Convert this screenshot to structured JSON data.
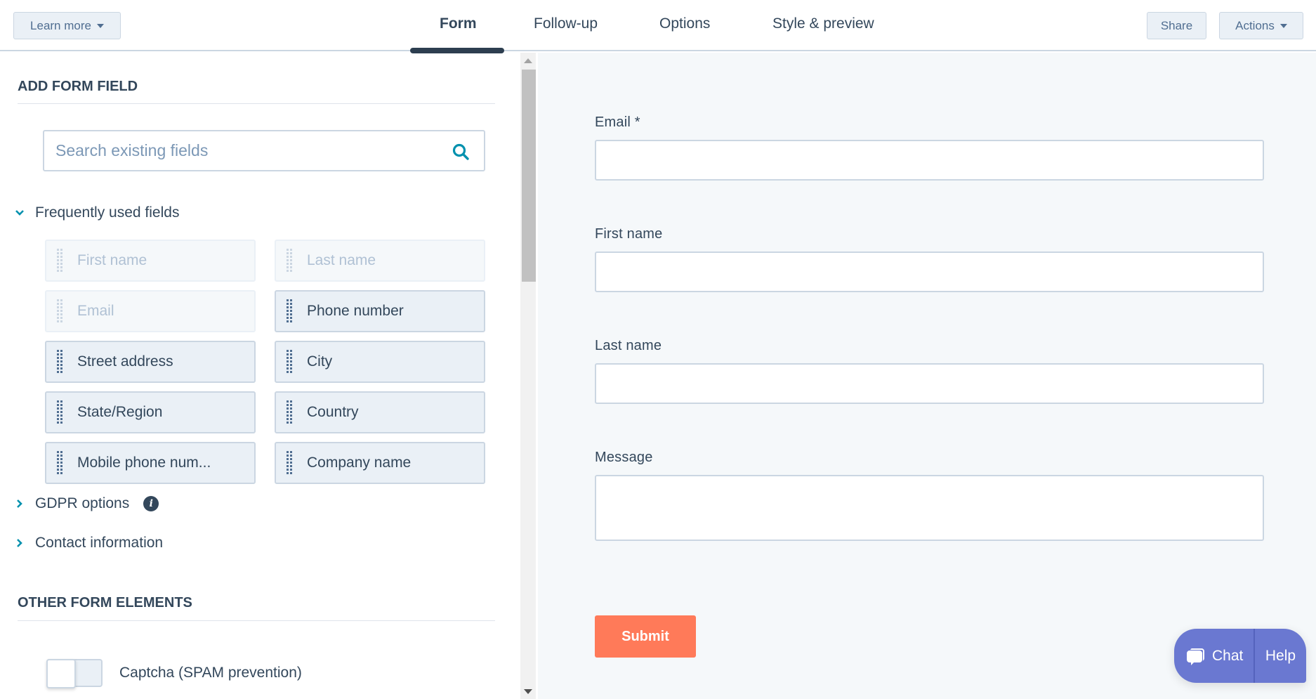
{
  "header": {
    "learn_more": "Learn more",
    "tabs": [
      {
        "label": "Form",
        "active": true
      },
      {
        "label": "Follow-up",
        "active": false
      },
      {
        "label": "Options",
        "active": false
      },
      {
        "label": "Style & preview",
        "active": false
      }
    ],
    "share": "Share",
    "actions": "Actions"
  },
  "left_panel": {
    "add_form_field_title": "ADD FORM FIELD",
    "search": {
      "placeholder": "Search existing fields",
      "value": ""
    },
    "frequently_used": {
      "label": "Frequently used fields",
      "expanded": true,
      "fields": [
        {
          "label": "First name",
          "enabled": false
        },
        {
          "label": "Last name",
          "enabled": false
        },
        {
          "label": "Email",
          "enabled": false
        },
        {
          "label": "Phone number",
          "enabled": true
        },
        {
          "label": "Street address",
          "enabled": true
        },
        {
          "label": "City",
          "enabled": true
        },
        {
          "label": "State/Region",
          "enabled": true
        },
        {
          "label": "Country",
          "enabled": true
        },
        {
          "label": "Mobile phone num...",
          "enabled": true
        },
        {
          "label": "Company name",
          "enabled": true
        }
      ]
    },
    "gdpr_options": {
      "label": "GDPR options",
      "expanded": false,
      "info_icon": "i"
    },
    "contact_information": {
      "label": "Contact information",
      "expanded": false
    },
    "other_form_elements_title": "OTHER FORM ELEMENTS",
    "captcha": {
      "label": "Captcha (SPAM prevention)",
      "enabled": false
    }
  },
  "preview": {
    "fields": [
      {
        "label": "Email *",
        "value": ""
      },
      {
        "label": "First name",
        "value": ""
      },
      {
        "label": "Last name",
        "value": ""
      },
      {
        "label": "Message",
        "value": ""
      }
    ],
    "submit": "Submit"
  },
  "chat_widget": {
    "chat": "Chat",
    "help": "Help"
  },
  "colors": {
    "accent_teal": "#0091ae",
    "submit_orange": "#ff7a59",
    "chat_purple": "#6a78d1",
    "text_dark": "#33475b",
    "tab_underline": "#2d3e50"
  }
}
